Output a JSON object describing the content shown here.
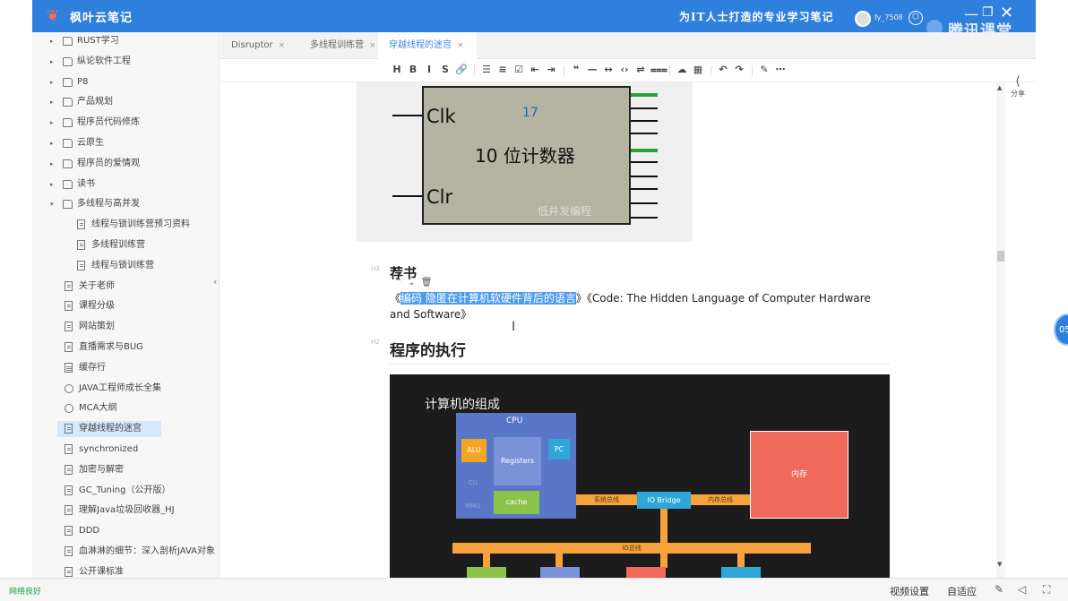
{
  "window": {
    "app_name": "枫叶云笔记",
    "slogan": "为IT人士打造的专业学习笔记",
    "username": "fy_7508",
    "overlay_brand": "腾讯课堂",
    "accent": "#2f7fdc"
  },
  "sidebar": {
    "items": [
      {
        "label": "RUST学习",
        "kind": "folder",
        "level": 1,
        "arrow": "▸"
      },
      {
        "label": "纵论软件工程",
        "kind": "folder",
        "level": 1,
        "arrow": "▸"
      },
      {
        "label": "P8",
        "kind": "folder",
        "level": 1,
        "arrow": "▸"
      },
      {
        "label": "产品规划",
        "kind": "folder",
        "level": 1,
        "arrow": "▸"
      },
      {
        "label": "程序员代码修炼",
        "kind": "folder",
        "level": 1,
        "arrow": "▸"
      },
      {
        "label": "云原生",
        "kind": "folder",
        "level": 1,
        "arrow": "▸"
      },
      {
        "label": "程序员的爱情观",
        "kind": "folder",
        "level": 1,
        "arrow": "▸"
      },
      {
        "label": "读书",
        "kind": "folder",
        "level": 1,
        "arrow": "▸"
      },
      {
        "label": "多线程与高并发",
        "kind": "folder",
        "level": 1,
        "arrow": "▾"
      },
      {
        "label": "线程与锁训练营预习资料",
        "kind": "file",
        "level": 2,
        "arrow": ""
      },
      {
        "label": "多线程训练营",
        "kind": "file",
        "level": 2,
        "arrow": ""
      },
      {
        "label": "线程与锁训练营",
        "kind": "file",
        "level": 2,
        "arrow": ""
      },
      {
        "label": "关于老师",
        "kind": "file",
        "level": 1,
        "arrow": ""
      },
      {
        "label": "课程分级",
        "kind": "file",
        "level": 1,
        "arrow": ""
      },
      {
        "label": "网站策划",
        "kind": "file",
        "level": 1,
        "arrow": ""
      },
      {
        "label": "直播需求与BUG",
        "kind": "file",
        "level": 1,
        "arrow": ""
      },
      {
        "label": "缓存行",
        "kind": "grid",
        "level": 1,
        "arrow": ""
      },
      {
        "label": "JAVA工程师成长全集",
        "kind": "gear",
        "level": 1,
        "arrow": ""
      },
      {
        "label": "MCA大纲",
        "kind": "gear",
        "level": 1,
        "arrow": ""
      },
      {
        "label": "穿越线程的迷宫",
        "kind": "file",
        "level": 1,
        "arrow": "",
        "selected": true
      },
      {
        "label": "synchronized",
        "kind": "file",
        "level": 1,
        "arrow": ""
      },
      {
        "label": "加密与解密",
        "kind": "file",
        "level": 1,
        "arrow": ""
      },
      {
        "label": "GC_Tuning（公开版）",
        "kind": "file",
        "level": 1,
        "arrow": ""
      },
      {
        "label": "理解Java垃圾回收器_HJ",
        "kind": "file",
        "level": 1,
        "arrow": ""
      },
      {
        "label": "DDD",
        "kind": "file",
        "level": 1,
        "arrow": ""
      },
      {
        "label": "血淋淋的细节：深入剖析JAVA对象",
        "kind": "file",
        "level": 1,
        "arrow": ""
      },
      {
        "label": "公开课标准",
        "kind": "file",
        "level": 1,
        "arrow": ""
      }
    ]
  },
  "tabs": [
    {
      "label": "Disruptor",
      "close": "×"
    },
    {
      "label": "多线程训练营",
      "close": "×"
    },
    {
      "label": "穿越线程的迷宫",
      "close": "×",
      "active": true
    }
  ],
  "toolbar": {
    "buttons": [
      "H",
      "B",
      "I",
      "S",
      "🔗",
      "|",
      "☰",
      "≡",
      "☑",
      "⇤",
      "⇥",
      "|",
      "❝",
      "—",
      "↔",
      "‹›",
      "⇌",
      "⩶",
      "|",
      "☁",
      "▦",
      "|",
      "↶",
      "↷",
      "|",
      "✎",
      "⋯"
    ]
  },
  "share_label": "分享",
  "content": {
    "counter_image": {
      "clk": "Clk",
      "clr": "Clr",
      "value": "17",
      "title": "10 位计数器",
      "watermark": "低并发编程"
    },
    "h3_marker": "H3",
    "h3_title": "荐书",
    "heading_tools": "⌃⌄🗑",
    "book_prefix": "《",
    "book_highlight": "编码 隐匿在计算机软硬件背后的语言",
    "book_suffix": "》《Code: The Hidden Language of Computer Hardware and Software》",
    "h2_marker": "H2",
    "h2_title": "程序的执行",
    "computer_image": {
      "title": "计算机的组成",
      "cpu": "CPU",
      "alu": "ALU",
      "registers": "Registers",
      "pc": "PC",
      "cache": "cache",
      "dim_text_1": "CU",
      "dim_text_2": "MMU",
      "memory": "内存",
      "io_bridge": "IO Bridge",
      "system_bus": "系统总线",
      "memory_bus": "内存总线",
      "io_bus": "IO总线"
    }
  },
  "statusbar": {
    "network": "网络良好",
    "video_settings": "视频设置",
    "auto_fit": "自适应"
  },
  "edge_badge": "05"
}
